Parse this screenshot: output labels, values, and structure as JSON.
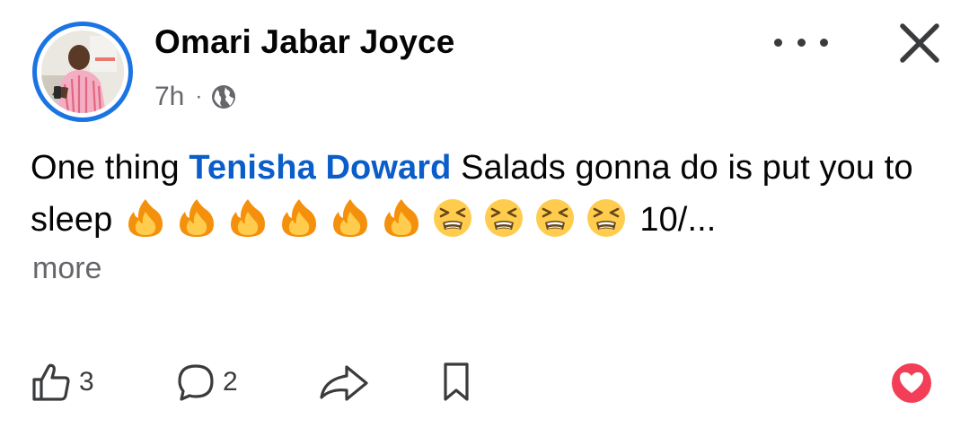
{
  "post": {
    "author": {
      "name": "Omari Jabar Joyce",
      "avatar": "profile-photo"
    },
    "meta": {
      "time": "7h",
      "separator": "·",
      "audience_icon": "globe-icon"
    },
    "header_actions": {
      "more_icon": "more-options-icon",
      "close_icon": "close-icon"
    },
    "body": {
      "text_before_mention": "One thing ",
      "mention": "Tenisha Doward",
      "text_after_mention": " Salads gonna do is put you to sleep",
      "emojis": [
        "fire-emoji",
        "fire-emoji",
        "fire-emoji",
        "fire-emoji",
        "fire-emoji",
        "fire-emoji",
        "tired-face-emoji",
        "tired-face-emoji",
        "tired-face-emoji",
        "tired-face-emoji"
      ],
      "truncated_tail": "10/...",
      "see_more": "more"
    },
    "actions": {
      "like_count": "3",
      "comment_count": "2",
      "like_icon": "thumbs-up-icon",
      "comment_icon": "comment-bubble-icon",
      "share_icon": "share-arrow-icon",
      "save_icon": "bookmark-icon",
      "reaction_icon": "heart-reaction-icon"
    },
    "colors": {
      "mention": "#0b5ec9",
      "avatar_ring": "#1b74e4",
      "secondary_text": "#65676b",
      "heart_reaction": "#f33e58"
    }
  }
}
